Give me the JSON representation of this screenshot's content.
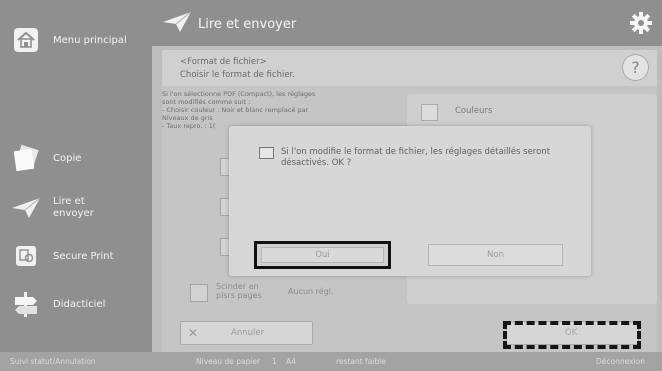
{
  "sidebar": {
    "items": [
      {
        "label": "Menu principal",
        "icon": "home-icon"
      },
      {
        "label": "Copie",
        "icon": "copy-icon"
      },
      {
        "label": "Lire et envoyer",
        "icon": "paper-plane-icon"
      },
      {
        "label": "Secure Print",
        "icon": "secure-print-icon"
      },
      {
        "label": "Didacticiel",
        "icon": "signpost-icon"
      }
    ]
  },
  "header": {
    "title": "Lire et envoyer",
    "icon": "paper-plane-icon",
    "settings_icon": "gear-icon"
  },
  "subheader": {
    "line1": "<Format de fichier>",
    "line2": "Choisir le format de fichier.",
    "help_label": "?"
  },
  "info": {
    "lines": [
      "Si l'on sélectionne PDF (Compact), les réglages",
      "sont modifiés comme suit :",
      "- Choisir couleur : Noir et blanc remplacé par",
      "Niveaux de gris",
      "- Taux repro. : 1("
    ]
  },
  "right_panel": {
    "color_label": "Couleurs"
  },
  "background_options": {
    "scinder_label": "Scinder en plsrs pages",
    "scinder_value": "Aucun régl."
  },
  "actions": {
    "cancel_label": "Annuler",
    "ok_label": "OK"
  },
  "status_bar": {
    "left": "Suivi statut/Annulation",
    "paper": "Niveau de papier",
    "tray": "1",
    "size": "A4",
    "toner": "restant faible",
    "logout": "Déconnexion"
  },
  "dialog": {
    "message": "Si l'on modifie le format de fichier, les réglages détaillés seront désactivés. OK ?",
    "yes_label": "Oui",
    "no_label": "Non"
  }
}
